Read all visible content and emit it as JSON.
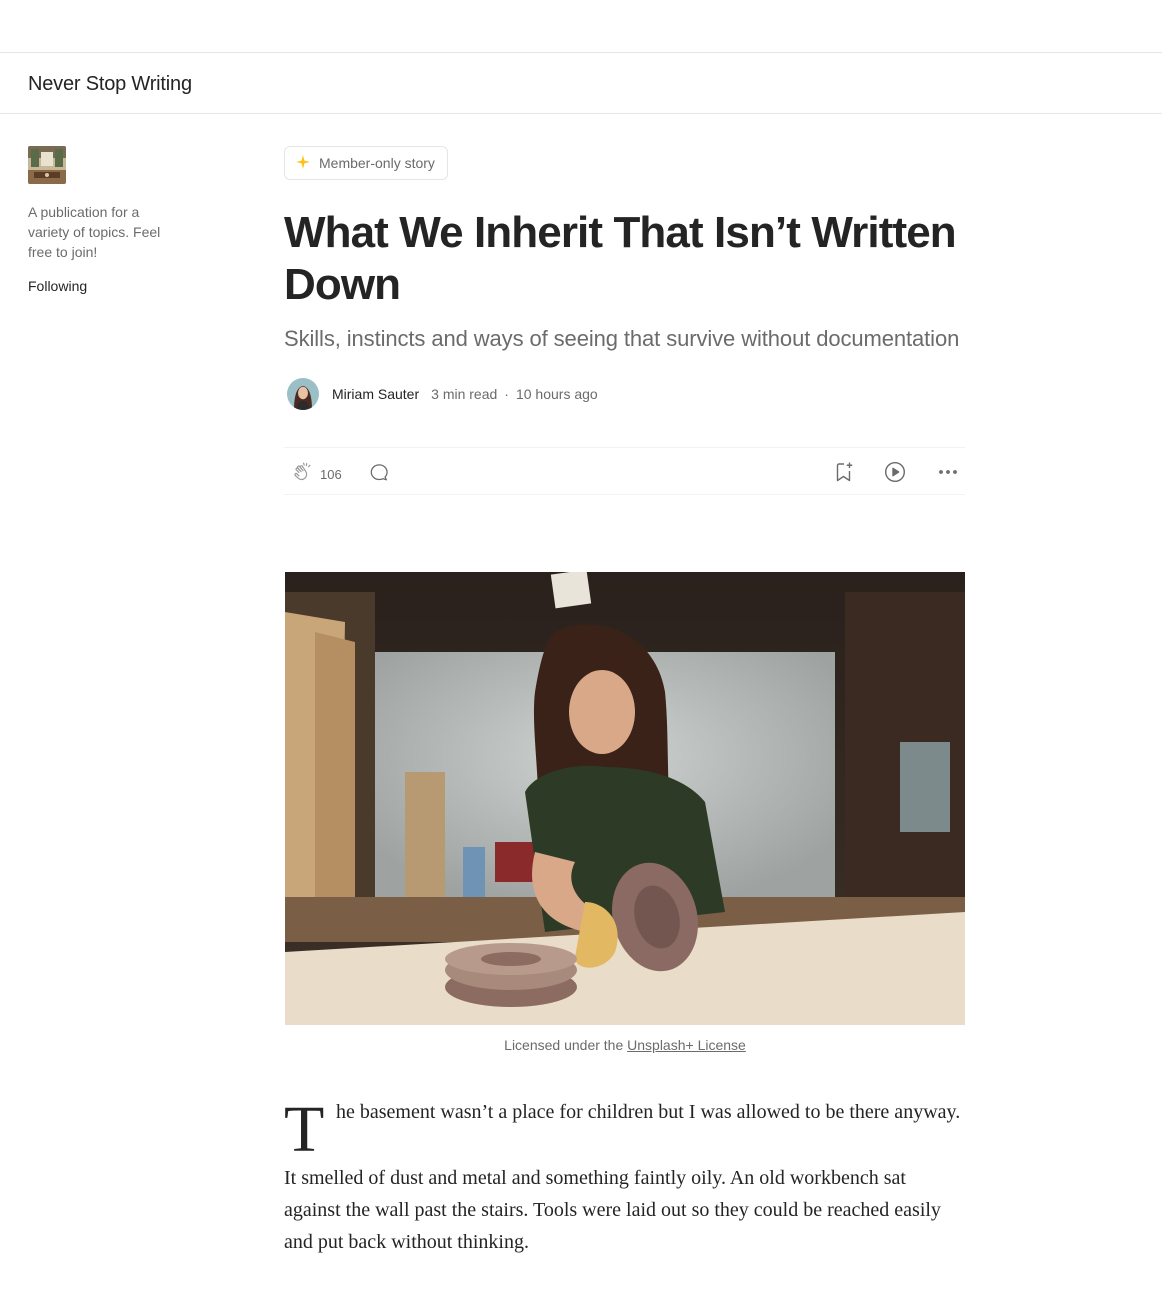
{
  "publication": {
    "name": "Never Stop Writing",
    "description": "A publication for a variety of topics. Feel free to join!",
    "follow_state": "Following"
  },
  "article": {
    "member_badge": "Member-only story",
    "title": "What We Inherit That Isn’t Written Down",
    "subtitle": "Skills, instincts and ways of seeing that survive without documentation",
    "author": "Miriam Sauter",
    "read_time": "3 min read",
    "separator": "·",
    "published": "10 hours ago",
    "claps": "106"
  },
  "hero_image": {
    "caption_prefix": "Licensed under the",
    "caption_link": "Unsplash+ License"
  },
  "body": {
    "dropcap": "T",
    "para1_rest": "he basement wasn’t a place for children but I was allowed to be there anyway.",
    "para2": "It smelled of dust and metal and something faintly oily. An old workbench sat against the wall past the stairs. Tools were laid out so they could be reached easily and put back without thinking."
  },
  "colors": {
    "accent_star": "#FFC017",
    "text": "#242424",
    "muted": "#6B6B6B",
    "divider": "#E6E6E6"
  },
  "icons": [
    "sparkle-icon",
    "clap-icon",
    "response-icon",
    "bookmark-add-icon",
    "listen-play-icon",
    "more-icon"
  ]
}
